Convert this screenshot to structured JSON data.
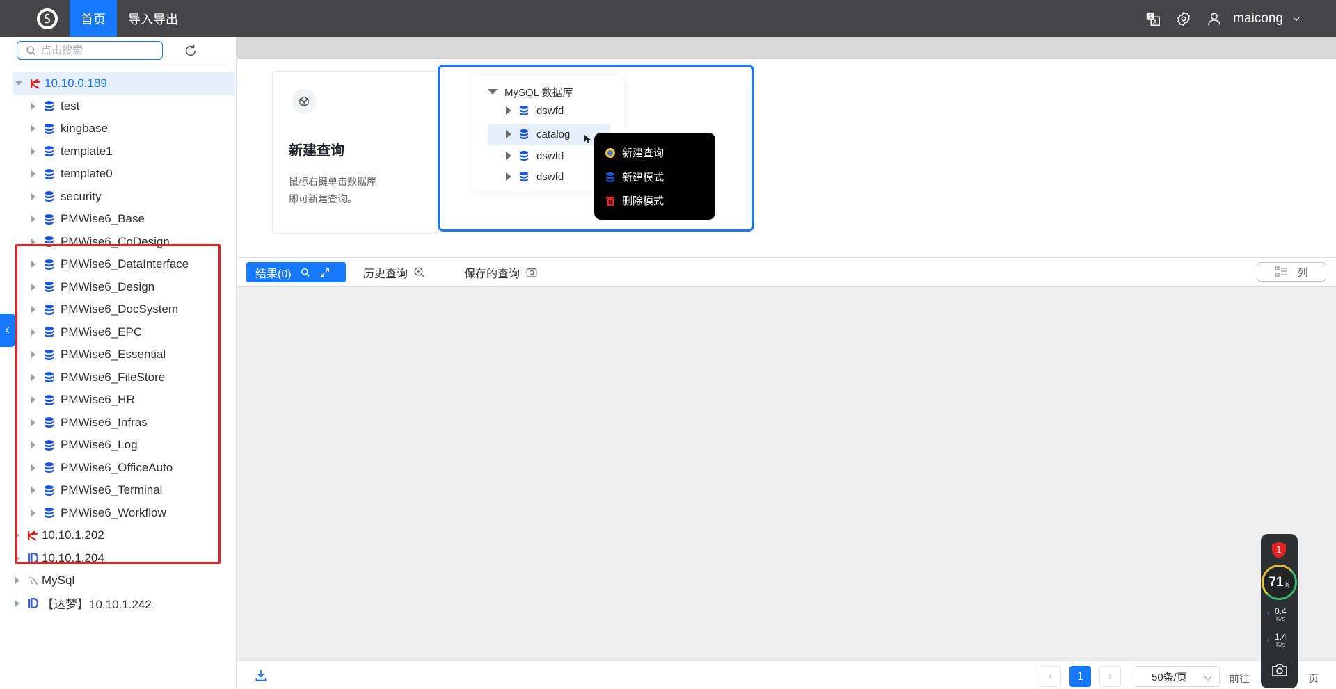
{
  "topbar": {
    "nav": [
      "首页",
      "导入导出"
    ],
    "username": "maicong"
  },
  "sidebar": {
    "search_placeholder": "点击搜索",
    "tree": [
      {
        "label": "10.10.0.189",
        "type": "kingbase",
        "expanded": true,
        "selected": true
      },
      {
        "label": "test",
        "level": 2
      },
      {
        "label": "kingbase",
        "level": 2
      },
      {
        "label": "template1",
        "level": 2
      },
      {
        "label": "template0",
        "level": 2
      },
      {
        "label": "security",
        "level": 2
      },
      {
        "label": "PMWise6_Base",
        "level": 2
      },
      {
        "label": "PMWise6_CoDesign",
        "level": 2
      },
      {
        "label": "PMWise6_DataInterface",
        "level": 2
      },
      {
        "label": "PMWise6_Design",
        "level": 2
      },
      {
        "label": "PMWise6_DocSystem",
        "level": 2
      },
      {
        "label": "PMWise6_EPC",
        "level": 2
      },
      {
        "label": "PMWise6_Essential",
        "level": 2
      },
      {
        "label": "PMWise6_FileStore",
        "level": 2
      },
      {
        "label": "PMWise6_HR",
        "level": 2
      },
      {
        "label": "PMWise6_Infras",
        "level": 2
      },
      {
        "label": "PMWise6_Log",
        "level": 2
      },
      {
        "label": "PMWise6_OfficeAuto",
        "level": 2
      },
      {
        "label": "PMWise6_Terminal",
        "level": 2
      },
      {
        "label": "PMWise6_Workflow",
        "level": 2
      },
      {
        "label": "10.10.1.202",
        "type": "kingbase"
      },
      {
        "label": "10.10.1.204",
        "type": "dameng"
      },
      {
        "label": "MySql",
        "type": "mysql"
      },
      {
        "label": "【达梦】10.10.1.242",
        "type": "dameng"
      }
    ]
  },
  "welcome": {
    "title": "新建查询",
    "desc_line1": "鼠标右键单击数据库",
    "desc_line2": "即可新建查询。",
    "demo": {
      "root": "MySQL 数据库",
      "items": [
        "dswfd",
        "catalog",
        "dswfd",
        "dswfd"
      ],
      "menu": [
        "新建查询",
        "新建模式",
        "删除模式"
      ]
    }
  },
  "tabs": {
    "results": "结果(0)",
    "history": "历史查询",
    "saved": "保存的查询",
    "columns": "列"
  },
  "pagination": {
    "current_page": "1",
    "page_size": "50条/页",
    "goto_label": "前往",
    "page_suffix": "页"
  },
  "monitor": {
    "alert_count": "1",
    "cpu_percent": "71",
    "percent_sign": "%",
    "upload": "0.4",
    "upload_unit": "K/s",
    "download": "1.4",
    "download_unit": "K/s"
  },
  "colors": {
    "accent": "#1677ff",
    "topbar": "#454547",
    "highlight_box": "#e02424"
  }
}
